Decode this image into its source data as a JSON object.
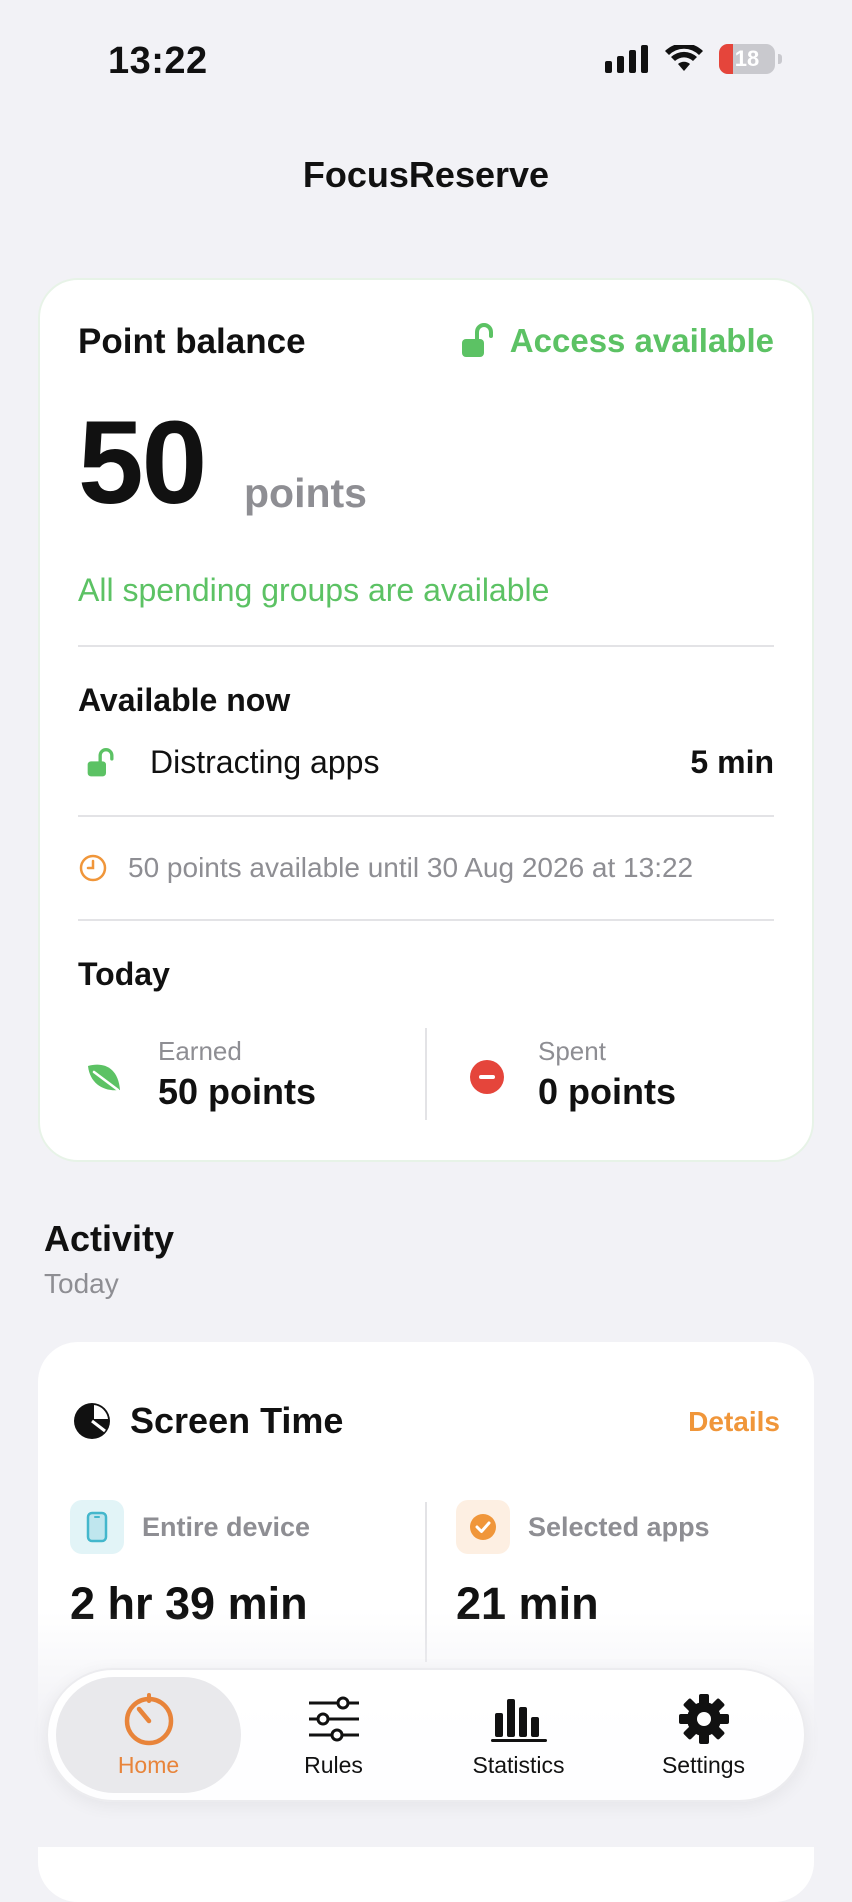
{
  "status_bar": {
    "time": "13:22",
    "battery": "18"
  },
  "app_title": "FocusReserve",
  "balance_card": {
    "title": "Point balance",
    "access_status": "Access available",
    "points_value": "50",
    "points_unit": "points",
    "groups_status": "All spending groups are available",
    "available_now": {
      "title": "Available now",
      "items": [
        {
          "name": "Distracting apps",
          "duration": "5 min"
        }
      ]
    },
    "expiry_note": "50 points available until 30 Aug 2026 at 13:22",
    "today": {
      "title": "Today",
      "earned_label": "Earned",
      "earned_value": "50 points",
      "spent_label": "Spent",
      "spent_value": "0 points"
    }
  },
  "activity": {
    "title": "Activity",
    "subtitle": "Today",
    "screen_time": {
      "title": "Screen Time",
      "details_label": "Details",
      "entire_device_label": "Entire device",
      "entire_device_value": "2 hr 39 min",
      "selected_apps_label": "Selected apps",
      "selected_apps_value": "21 min"
    }
  },
  "tab_bar": {
    "active": "Home",
    "tabs": [
      {
        "label": "Home",
        "icon": "timer-icon"
      },
      {
        "label": "Rules",
        "icon": "sliders-icon"
      },
      {
        "label": "Statistics",
        "icon": "bar-chart-icon"
      },
      {
        "label": "Settings",
        "icon": "gear-icon"
      }
    ]
  },
  "colors": {
    "accent_green": "#5cc264",
    "accent_orange": "#f0963a",
    "danger_red": "#e5453b"
  }
}
